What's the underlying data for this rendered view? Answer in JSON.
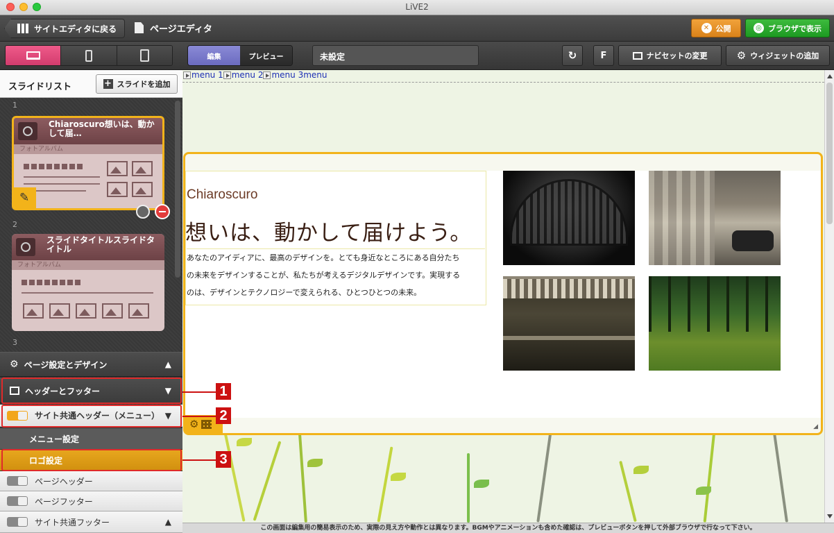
{
  "window": {
    "title": "LiVE2"
  },
  "toolbar": {
    "back_label": "サイトエディタに戻る",
    "page_title": "ページエディタ",
    "publish_label": "公開",
    "browser_label": "ブラウザで表示"
  },
  "toolbar2": {
    "mode_edit": "編集",
    "mode_preview": "プレビュー",
    "setting_value": "未設定",
    "refresh_icon": "refresh-icon",
    "f_label": "F",
    "navset_label": "ナビセットの変更",
    "widget_label": "ウィジェットの追加"
  },
  "sidebar": {
    "slide_list_title": "スライドリスト",
    "add_slide_label": "スライドを追加",
    "slides": [
      {
        "num": "1",
        "title": "Chiaroscuro想いは、動かして届…",
        "subtitle": "フォトアルバム"
      },
      {
        "num": "2",
        "title": "スライドタイトルスライドタイトル",
        "subtitle": "フォトアルバム"
      },
      {
        "num": "3"
      }
    ],
    "page_design_label": "ページ設定とデザイン",
    "header_footer_label": "ヘッダーとフッター",
    "site_header_label": "サイト共通ヘッダー（メニュー）",
    "menu_setting_label": "メニュー設定",
    "logo_setting_label": "ロゴ設定",
    "page_header_label": "ページヘッダー",
    "page_footer_label": "ページフッター",
    "site_footer_label": "サイト共通フッター"
  },
  "callouts": {
    "c1": "1",
    "c2": "2",
    "c3": "3"
  },
  "canvas": {
    "menu": [
      "menu 1",
      "menu 2",
      "menu 3menu"
    ],
    "hero_en": "Chiaroscuro",
    "hero_jp": "想いは、動かして届けよう。",
    "hero_body_1": "あなたのアイディアに、最高のデザインを。とても身近なところにある自分たち",
    "hero_body_2": "の未来をデザインすることが、私たちが考えるデジタルデザインです。実現する",
    "hero_body_3": "のは、デザインとテクノロジーで変えられる、ひとつひとつの未来。"
  },
  "footer_note": "この画面は編集用の簡易表示のため、実際の見え方や動作とは異なります。BGMやアニメーションも含めた確認は、プレビューボタンを押して外部ブラウザで行なって下さい。",
  "colors": {
    "accent": "#f2b31a",
    "device_active": "#e04a7c",
    "publish": "#e8921f",
    "browser": "#2aa62f",
    "callout": "#cc1111"
  }
}
